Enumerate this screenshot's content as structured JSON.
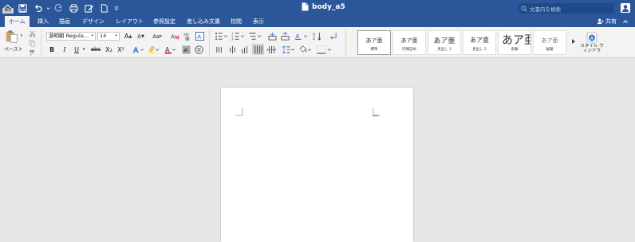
{
  "title_bar": {
    "document_title": "body_a5",
    "tooltip": "保存",
    "search_placeholder": "文書内を検索",
    "qat_icons": [
      "home-icon",
      "save-icon",
      "undo-icon",
      "redo-icon",
      "print-icon",
      "edit-icon",
      "new-document-icon",
      "customize-icon"
    ]
  },
  "tabs": [
    {
      "label": "ホーム",
      "active": true
    },
    {
      "label": "挿入"
    },
    {
      "label": "描画"
    },
    {
      "label": "デザイン"
    },
    {
      "label": "レイアウト"
    },
    {
      "label": "参照設定"
    },
    {
      "label": "差し込み文書"
    },
    {
      "label": "校閲"
    },
    {
      "label": "表示"
    }
  ],
  "share_label": "共有",
  "ribbon": {
    "paste_label": "ペースト",
    "font_name": "游明朝 Regula...",
    "font_size": "14",
    "bold": "B",
    "italic": "I",
    "underline": "U",
    "strikethrough": "abc",
    "subscript": "X₂",
    "superscript": "X²",
    "grow_font": "A",
    "shrink_font": "A",
    "change_case": "Aa",
    "font_color_letter": "A",
    "shading_letter": "A",
    "enclosed_char": "字",
    "styles_pane_label": "スタイル ウィンドウ"
  },
  "styles": [
    {
      "sample": "あア亜",
      "name": "標準",
      "selected": true
    },
    {
      "sample": "あア亜",
      "name": "行間詰め"
    },
    {
      "sample": "あア亜",
      "name": "見出し 1"
    },
    {
      "sample": "あア亜",
      "name": "見出し 2"
    },
    {
      "sample": "あア亜",
      "name": "表題"
    },
    {
      "sample": "あア亜",
      "name": "副題"
    }
  ],
  "colors": {
    "brand": "#2b579a",
    "ribbon": "#f3f3f3",
    "canvas": "#e6e6e6",
    "font_color": "#e81123",
    "highlight": "#ffff00"
  }
}
